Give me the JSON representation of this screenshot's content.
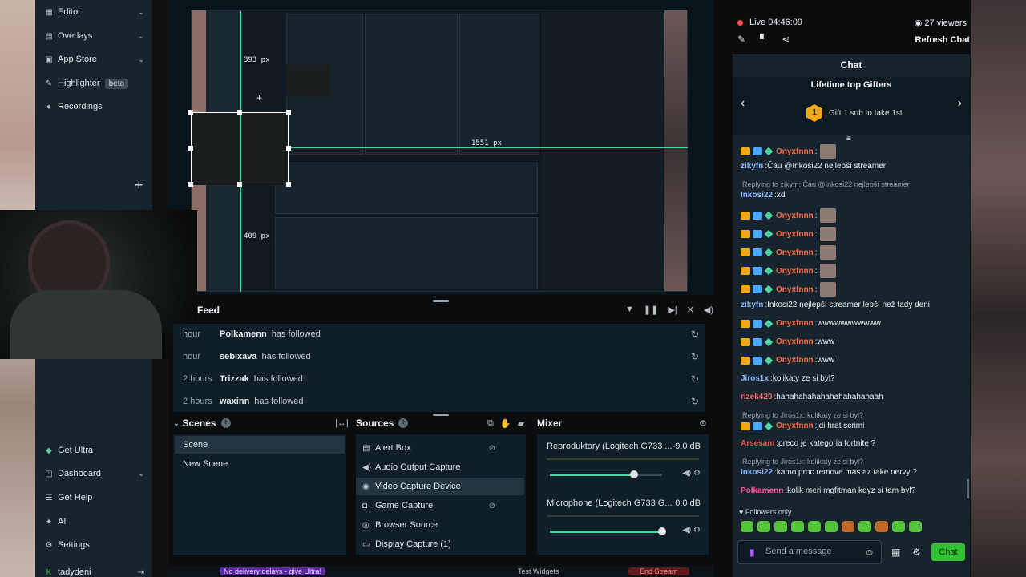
{
  "nav": {
    "items": [
      {
        "label": "Editor",
        "icon": "editor-icon"
      },
      {
        "label": "Overlays",
        "icon": "overlays-icon"
      },
      {
        "label": "App Store",
        "icon": "app-store-icon"
      },
      {
        "label": "Highlighter",
        "badge": "beta",
        "icon": "highlighter-icon"
      },
      {
        "label": "Recordings",
        "icon": "recordings-icon"
      }
    ],
    "bottom": [
      {
        "label": "Get Ultra",
        "icon": "ultra-icon"
      },
      {
        "label": "Dashboard",
        "icon": "dashboard-icon"
      },
      {
        "label": "Get Help",
        "icon": "help-icon"
      },
      {
        "label": "AI",
        "icon": "ai-icon"
      },
      {
        "label": "Settings",
        "icon": "settings-icon"
      },
      {
        "label": "tadydeni",
        "icon": "user-icon"
      }
    ]
  },
  "preview": {
    "measure_top": "393 px",
    "measure_left": "409 px",
    "measure_right": "1551 px"
  },
  "feed": {
    "title": "Feed",
    "rows": [
      {
        "time": "hour",
        "user": "Polkamenn",
        "action": "has followed"
      },
      {
        "time": "hour",
        "user": "sebixava",
        "action": "has followed"
      },
      {
        "time": "2 hours",
        "user": "Trizzak",
        "action": "has followed"
      },
      {
        "time": "2 hours",
        "user": "waxinn",
        "action": "has followed"
      }
    ]
  },
  "scenes": {
    "title": "Scenes",
    "items": [
      "Scene",
      "New Scene"
    ]
  },
  "sources": {
    "title": "Sources",
    "items": [
      "Alert Box",
      "Audio Output Capture",
      "Video Capture Device",
      "Game Capture",
      "Browser Source",
      "Display Capture (1)"
    ]
  },
  "mixer": {
    "title": "Mixer",
    "channels": [
      {
        "name": "Reproduktory (Logitech G733 ...",
        "db": "-9.0 dB",
        "level": 0.75
      },
      {
        "name": "Microphone (Logitech G733 G...",
        "db": "0.0 dB",
        "level": 1.0
      }
    ]
  },
  "footer": {
    "warning": "No delivery delays - give Ultra!",
    "test_widgets": "Test Widgets",
    "end_stream": "End Stream"
  },
  "live": {
    "status": "Live 04:46:09",
    "viewers": "27 viewers",
    "refresh": "Refresh Chat"
  },
  "chat": {
    "title": "Chat",
    "gifters_title": "Lifetime top Gifters",
    "gift_badge": "1",
    "gift_text": "Gift 1 sub to take 1st",
    "messages": [
      {
        "name": "Onyxfnnn",
        "text": "",
        "color": "#ff6a3d",
        "badges": true,
        "emote": true
      },
      {
        "name": "zikyfn",
        "text": "Čau @Inkosi22 nejlepší streamer",
        "color": "#8ab4ff",
        "badges": false,
        "emote": false
      },
      {
        "reply": "Replying to zikyfn: Čau @Inkosi22 nejlepší streamer"
      },
      {
        "name": "Inkosi22",
        "text": "xd",
        "color": "#8ab4ff",
        "badges": false,
        "emote": false
      },
      {
        "name": "Onyxfnnn",
        "text": "",
        "color": "#ff6a3d",
        "badges": true,
        "emote": true
      },
      {
        "name": "Onyxfnnn",
        "text": "",
        "color": "#ff6a3d",
        "badges": true,
        "emote": true
      },
      {
        "name": "Onyxfnnn",
        "text": "",
        "color": "#ff6a3d",
        "badges": true,
        "emote": true
      },
      {
        "name": "Onyxfnnn",
        "text": "",
        "color": "#ff6a3d",
        "badges": true,
        "emote": true
      },
      {
        "name": "Onyxfnnn",
        "text": "",
        "color": "#ff6a3d",
        "badges": true,
        "emote": true
      },
      {
        "name": "zikyfn",
        "text": "Inkosi22 nejlepší streamer lepší než tady deni",
        "color": "#8ab4ff",
        "badges": false,
        "emote": false
      },
      {
        "name": "Onyxfnnn",
        "text": "wwwwwwwwwww",
        "color": "#ff6a3d",
        "badges": true,
        "emote": false
      },
      {
        "name": "Onyxfnnn",
        "text": "www",
        "color": "#ff6a3d",
        "badges": true,
        "emote": false
      },
      {
        "name": "Onyxfnnn",
        "text": "www",
        "color": "#ff6a3d",
        "badges": true,
        "emote": false
      },
      {
        "name": "Jiros1x",
        "text": "kolikaty ze si byl?",
        "color": "#8ab4ff",
        "badges": false,
        "emote": false
      },
      {
        "name": "rizek420",
        "text": "hahahahahahahahahahahaah",
        "color": "#ff6a6a",
        "badges": false,
        "emote": false
      },
      {
        "reply": "Replying to Jiros1x: kolikaty ze si byl?"
      },
      {
        "name": "Onyxfnnn",
        "text": "jdi hrat scrimi",
        "color": "#ff6a3d",
        "badges": true,
        "emote": false
      },
      {
        "name": "Arsesam",
        "text": "preco je kategoria fortnite ?",
        "color": "#ff4d4d",
        "badges": false,
        "emote": false
      },
      {
        "reply": "Replying to Jiros1x: kolikaty ze si byl?"
      },
      {
        "name": "Inkosi22",
        "text": "kamo proc remove mas az take nervy ?",
        "color": "#8ab4ff",
        "badges": false,
        "emote": false
      },
      {
        "name": "Polkamenn",
        "text": "kolik meri mgfitman kdyz si tam byl?",
        "color": "#ff5aa5",
        "badges": false,
        "emote": false
      }
    ],
    "followers_only": "Followers only",
    "input_placeholder": "Send a message",
    "send_label": "Chat"
  },
  "colors": {
    "accent": "#31c331",
    "live_dot": "#ff4d4d",
    "panel_bg": "#0f1e27",
    "nav_bg": "#17242d"
  }
}
